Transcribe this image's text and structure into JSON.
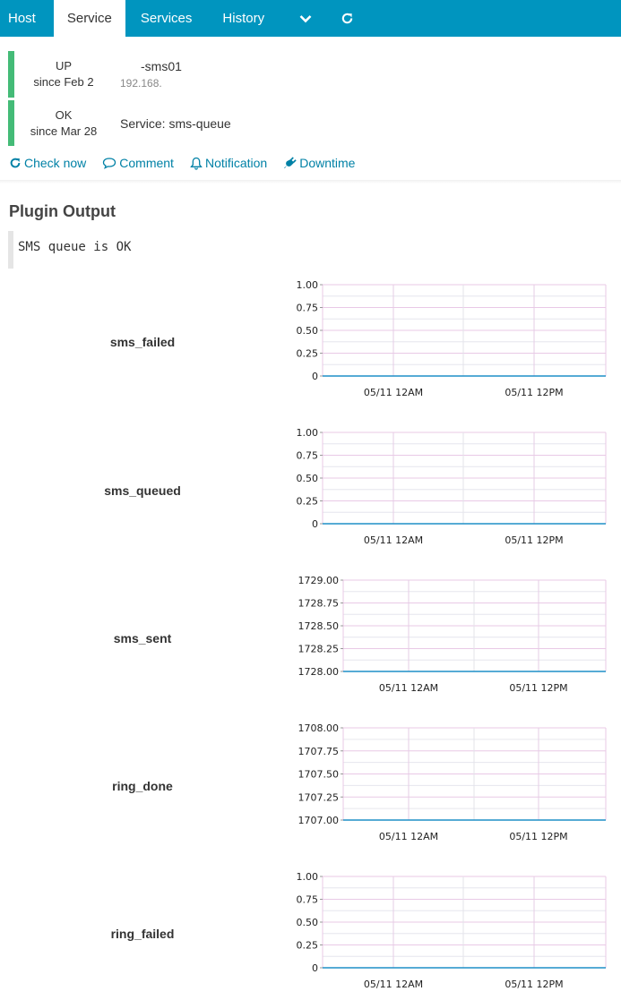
{
  "tabs": {
    "host": "Host",
    "service": "Service",
    "services": "Services",
    "history": "History",
    "more_icon": "chevron-down-icon",
    "refresh_icon": "refresh-icon"
  },
  "host": {
    "state": "UP",
    "since": "since Feb 2",
    "name": "-sms01",
    "address": "192.168.",
    "state_color": "#44bb77"
  },
  "service": {
    "state": "OK",
    "since": "since Mar 28",
    "label": "Service: sms-queue",
    "state_color": "#44bb77"
  },
  "actions": {
    "check_now": "Check now",
    "comment": "Comment",
    "notification": "Notification",
    "downtime": "Downtime"
  },
  "plugin": {
    "title": "Plugin Output",
    "output": "SMS queue is OK"
  },
  "chart_data": [
    {
      "type": "line",
      "metric": "sms_failed",
      "yticks": [
        "1.00",
        "0.75",
        "0.50",
        "0.25",
        "0"
      ],
      "ylim": [
        0,
        1
      ],
      "xticks": [
        "05/11 12AM",
        "05/11 12PM"
      ],
      "series": [
        {
          "values": [
            0,
            0
          ]
        }
      ],
      "line_color": "#1f8fc7",
      "grid": true
    },
    {
      "type": "line",
      "metric": "sms_queued",
      "yticks": [
        "1.00",
        "0.75",
        "0.50",
        "0.25",
        "0"
      ],
      "ylim": [
        0,
        1
      ],
      "xticks": [
        "05/11 12AM",
        "05/11 12PM"
      ],
      "series": [
        {
          "values": [
            0,
            0
          ]
        }
      ],
      "line_color": "#1f8fc7",
      "grid": true
    },
    {
      "type": "line",
      "metric": "sms_sent",
      "yticks": [
        "1729.00",
        "1728.75",
        "1728.50",
        "1728.25",
        "1728.00"
      ],
      "ylim": [
        1728,
        1729
      ],
      "xticks": [
        "05/11 12AM",
        "05/11 12PM"
      ],
      "series": [
        {
          "values": [
            1728,
            1728
          ]
        }
      ],
      "line_color": "#1f8fc7",
      "grid": true
    },
    {
      "type": "line",
      "metric": "ring_done",
      "yticks": [
        "1708.00",
        "1707.75",
        "1707.50",
        "1707.25",
        "1707.00"
      ],
      "ylim": [
        1707,
        1708
      ],
      "xticks": [
        "05/11 12AM",
        "05/11 12PM"
      ],
      "series": [
        {
          "values": [
            1707,
            1707
          ]
        }
      ],
      "line_color": "#1f8fc7",
      "grid": true
    },
    {
      "type": "line",
      "metric": "ring_failed",
      "yticks": [
        "1.00",
        "0.75",
        "0.50",
        "0.25",
        "0"
      ],
      "ylim": [
        0,
        1
      ],
      "xticks": [
        "05/11 12AM",
        "05/11 12PM"
      ],
      "series": [
        {
          "values": [
            0,
            0
          ]
        }
      ],
      "line_color": "#1f8fc7",
      "grid": true
    }
  ]
}
